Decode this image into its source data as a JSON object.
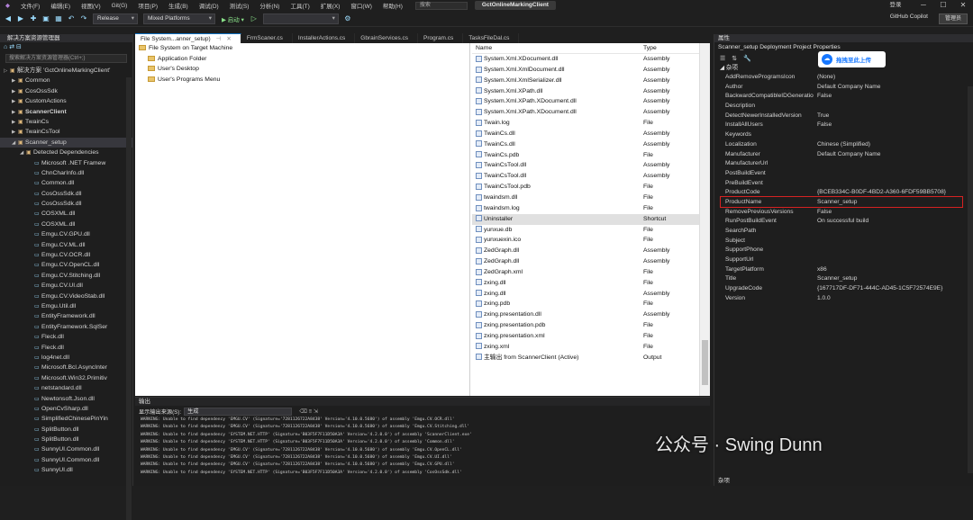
{
  "menu": {
    "items": [
      "文件(F)",
      "编辑(E)",
      "视图(V)",
      "Git(G)",
      "项目(P)",
      "生成(B)",
      "调试(D)",
      "测试(S)",
      "分析(N)",
      "工具(T)",
      "扩展(X)",
      "窗口(W)",
      "帮助(H)"
    ],
    "search": "搜索",
    "title": "GctOnlineMarkingClient",
    "user": "登录"
  },
  "toolbar": {
    "config": "Release",
    "platform": "Mixed Platforms",
    "start": "▶ 启动 ▾",
    "copilot": "GitHub Copilot",
    "admin": "管理员"
  },
  "solution": {
    "header": "解决方案资源管理器",
    "search": "搜索解决方案资源管理器(Ctrl+;)",
    "items": [
      {
        "t": "解决方案 'GctOnlineMarkingClient'",
        "lv": 0,
        "tw": "▷"
      },
      {
        "t": "Common",
        "lv": 1,
        "tw": "▶"
      },
      {
        "t": "CosOssSdk",
        "lv": 1,
        "tw": "▶"
      },
      {
        "t": "CustomActions",
        "lv": 1,
        "tw": "▶"
      },
      {
        "t": "ScannerClient",
        "lv": 1,
        "tw": "▶",
        "b": true
      },
      {
        "t": "TwainCs",
        "lv": 1,
        "tw": "▶"
      },
      {
        "t": "TwainCsTool",
        "lv": 1,
        "tw": "▶"
      },
      {
        "t": "Scanner_setup",
        "lv": 1,
        "tw": "◢",
        "s": true
      },
      {
        "t": "Detected Dependencies",
        "lv": 2,
        "tw": "◢"
      },
      {
        "t": "Microsoft .NET Framew",
        "lv": 3
      },
      {
        "t": "ChnCharInfo.dll",
        "lv": 3
      },
      {
        "t": "Common.dll",
        "lv": 3
      },
      {
        "t": "CosOssSdk.dll",
        "lv": 3
      },
      {
        "t": "CosOssSdk.dll",
        "lv": 3
      },
      {
        "t": "COSXML.dll",
        "lv": 3
      },
      {
        "t": "COSXML.dll",
        "lv": 3
      },
      {
        "t": "Emgu.CV.GPU.dll",
        "lv": 3
      },
      {
        "t": "Emgu.CV.ML.dll",
        "lv": 3
      },
      {
        "t": "Emgu.CV.OCR.dll",
        "lv": 3
      },
      {
        "t": "Emgu.CV.OpenCL.dll",
        "lv": 3
      },
      {
        "t": "Emgu.CV.Stitching.dll",
        "lv": 3
      },
      {
        "t": "Emgu.CV.UI.dll",
        "lv": 3
      },
      {
        "t": "Emgu.CV.VideoStab.dll",
        "lv": 3
      },
      {
        "t": "Emgu.Util.dll",
        "lv": 3
      },
      {
        "t": "EntityFramework.dll",
        "lv": 3
      },
      {
        "t": "EntityFramework.SqlSer",
        "lv": 3
      },
      {
        "t": "Fleck.dll",
        "lv": 3
      },
      {
        "t": "Fleck.dll",
        "lv": 3
      },
      {
        "t": "log4net.dll",
        "lv": 3
      },
      {
        "t": "Microsoft.Bcl.AsyncInter",
        "lv": 3
      },
      {
        "t": "Microsoft.Win32.Primitiv",
        "lv": 3
      },
      {
        "t": "netstandard.dll",
        "lv": 3
      },
      {
        "t": "Newtonsoft.Json.dll",
        "lv": 3
      },
      {
        "t": "OpenCvSharp.dll",
        "lv": 3
      },
      {
        "t": "SimplifiedChinesePinYin",
        "lv": 3
      },
      {
        "t": "SplitButton.dll",
        "lv": 3
      },
      {
        "t": "SplitButton.dll",
        "lv": 3
      },
      {
        "t": "SunnyUI.Common.dll",
        "lv": 3
      },
      {
        "t": "SunnyUI.Common.dll",
        "lv": 3
      },
      {
        "t": "SunnyUI.dll",
        "lv": 3
      }
    ]
  },
  "tabs": [
    {
      "label": "File System...anner_setup)",
      "active": true
    },
    {
      "label": "FrmScaner.cs"
    },
    {
      "label": "InstallerActions.cs"
    },
    {
      "label": "GbrainServices.cs"
    },
    {
      "label": "Program.cs"
    },
    {
      "label": "TasksFileDal.cs"
    }
  ],
  "filesystem": {
    "root": "File System on Target Machine",
    "folders": [
      "Application Folder",
      "User's Desktop",
      "User's Programs Menu"
    ],
    "col_name": "Name",
    "col_type": "Type",
    "rows": [
      [
        "System.Xml.XDocument.dll",
        "Assembly"
      ],
      [
        "System.Xml.XmlDocument.dll",
        "Assembly"
      ],
      [
        "System.Xml.XmlSerializer.dll",
        "Assembly"
      ],
      [
        "System.Xml.XPath.dll",
        "Assembly"
      ],
      [
        "System.Xml.XPath.XDocument.dll",
        "Assembly"
      ],
      [
        "System.Xml.XPath.XDocument.dll",
        "Assembly"
      ],
      [
        "Twain.log",
        "File"
      ],
      [
        "TwainCs.dll",
        "Assembly"
      ],
      [
        "TwainCs.dll",
        "Assembly"
      ],
      [
        "TwainCs.pdb",
        "File"
      ],
      [
        "TwainCsTool.dll",
        "Assembly"
      ],
      [
        "TwainCsTool.dll",
        "Assembly"
      ],
      [
        "TwainCsTool.pdb",
        "File"
      ],
      [
        "twaindsm.dll",
        "File"
      ],
      [
        "twaindsm.log",
        "File"
      ],
      [
        "Uninstaller",
        "Shortcut"
      ],
      [
        "yunxue.db",
        "File"
      ],
      [
        "yunxuexin.ico",
        "File"
      ],
      [
        "ZedGraph.dll",
        "Assembly"
      ],
      [
        "ZedGraph.dll",
        "Assembly"
      ],
      [
        "ZedGraph.xml",
        "File"
      ],
      [
        "zxing.dll",
        "File"
      ],
      [
        "zxing.dll",
        "Assembly"
      ],
      [
        "zxing.pdb",
        "File"
      ],
      [
        "zxing.presentation.dll",
        "Assembly"
      ],
      [
        "zxing.presentation.pdb",
        "File"
      ],
      [
        "zxing.presentation.xml",
        "File"
      ],
      [
        "zxing.xml",
        "File"
      ],
      [
        "主输出 from ScannerClient (Active)",
        "Output"
      ]
    ],
    "selected_row": 15
  },
  "output": {
    "header": "输出",
    "source_label": "显示输出来源(S):",
    "source_value": "生成",
    "lines": [
      "WARNING: Unable to find dependency 'EMGU.CV' (Signature='7281126722A8438' Version='4.10.0.5680') of assembly 'Emgu.CV.OCR.dll'",
      "WARNING: Unable to find dependency 'EMGU.CV' (Signature='7281126722A8438' Version='4.10.0.5680') of assembly 'Emgu.CV.Stitching.dll'",
      "WARNING: Unable to find dependency 'SYSTEM.NET.HTTP' (Signature='B03F5F7F11D50A3A' Version='4.2.0.0') of assembly 'ScannerClient.exe'",
      "WARNING: Unable to find dependency 'SYSTEM.NET.HTTP' (Signature='B03F5F7F11D50A3A' Version='4.2.0.0') of assembly 'Common.dll'",
      "WARNING: Unable to find dependency 'EMGU.CV' (Signature='7281126722A8438' Version='4.10.0.5680') of assembly 'Emgu.CV.OpenCL.dll'",
      "WARNING: Unable to find dependency 'EMGU.CV' (Signature='7281126722A8438' Version='4.10.0.5680') of assembly 'Emgu.CV.UI.dll'",
      "WARNING: Unable to find dependency 'EMGU.CV' (Signature='7281126722A8438' Version='4.10.0.5680') of assembly 'Emgu.CV.GPU.dll'",
      "WARNING: Unable to find dependency 'SYSTEM.NET.HTTP' (Signature='B03F5F7F11D50A3A' Version='4.2.0.0') of assembly 'CosOssSdk.dll'"
    ]
  },
  "properties": {
    "header": "属性",
    "subject": "Scanner_setup  Deployment Project Properties",
    "category": "杂项",
    "rows": [
      [
        "AddRemoveProgramsIcon",
        "(None)"
      ],
      [
        "Author",
        "Default Company Name"
      ],
      [
        "BackwardCompatibleIDGeneratio",
        "False"
      ],
      [
        "Description",
        ""
      ],
      [
        "DetectNewerInstalledVersion",
        "True"
      ],
      [
        "InstallAllUsers",
        "False"
      ],
      [
        "Keywords",
        ""
      ],
      [
        "Localization",
        "Chinese (Simplified)"
      ],
      [
        "Manufacturer",
        "Default Company Name"
      ],
      [
        "ManufacturerUrl",
        ""
      ],
      [
        "PostBuildEvent",
        ""
      ],
      [
        "PreBuildEvent",
        ""
      ],
      [
        "ProductCode",
        "{BCEB334C-B0DF-4BD2-A360-6FDF59BB5708}"
      ],
      [
        "ProductName",
        "Scanner_setup"
      ],
      [
        "RemovePreviousVersions",
        "False"
      ],
      [
        "RunPostBuildEvent",
        "On successful build"
      ],
      [
        "SearchPath",
        ""
      ],
      [
        "Subject",
        ""
      ],
      [
        "SupportPhone",
        ""
      ],
      [
        "SupportUrl",
        ""
      ],
      [
        "TargetPlatform",
        "x86"
      ],
      [
        "Title",
        "Scanner_setup"
      ],
      [
        "UpgradeCode",
        "{167717DF-DF71-444C-AD45-1C5F72574E9E}"
      ],
      [
        "Version",
        "1.0.0"
      ]
    ],
    "bottom_label": "杂项"
  },
  "badge": "拖拽至此上传",
  "watermark": "公众号 · Swing Dunn",
  "colors": {
    "accent": "#0e70c0",
    "highlight": "#d62222"
  }
}
